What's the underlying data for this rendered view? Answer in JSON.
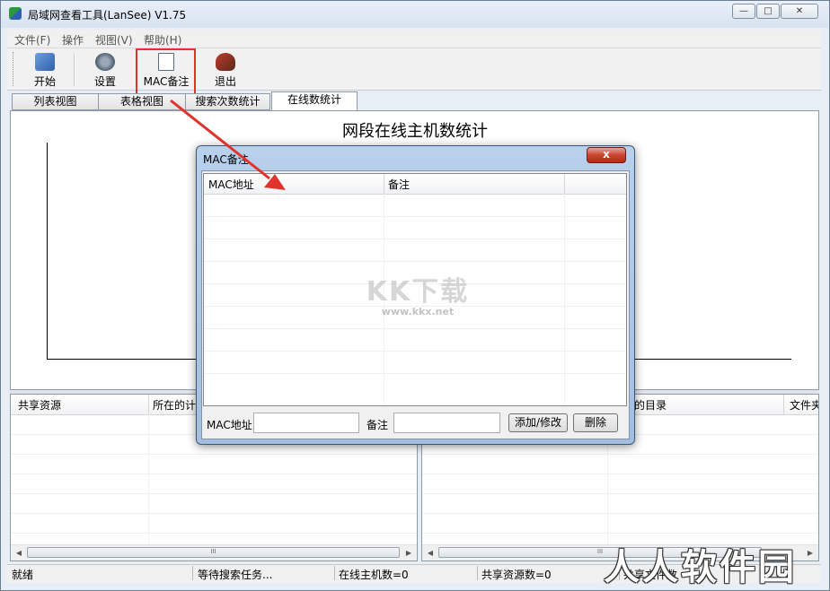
{
  "window": {
    "title": "局域网查看工具(LanSee) V1.75",
    "controls": {
      "minimize": "—",
      "maximize": "□",
      "close": "✕"
    }
  },
  "menu": [
    "文件(F)",
    "操作",
    "视图(V)",
    "帮助(H)"
  ],
  "toolbar": [
    {
      "label": "开始",
      "icon": "start-icon"
    },
    {
      "label": "设置",
      "icon": "settings-icon"
    },
    {
      "label": "MAC备注",
      "icon": "mac-note-icon"
    },
    {
      "label": "退出",
      "icon": "exit-icon"
    }
  ],
  "tabs": [
    "列表视图",
    "表格视图",
    "搜索次数统计",
    "在线数统计"
  ],
  "active_tab": "在线数统计",
  "chart": {
    "title": "网段在线主机数统计"
  },
  "left_list": {
    "columns": [
      "共享资源",
      "所在的计"
    ],
    "scroll_thumb": "III"
  },
  "right_list": {
    "columns": [
      "的目录",
      "文件夹"
    ],
    "scroll_thumb": "III"
  },
  "status": [
    "就绪",
    "等待搜索任务...",
    "在线主机数=0",
    "共享资源数=0",
    "共享文件数"
  ],
  "dialog": {
    "title": "MAC备注",
    "close_label": "x",
    "columns": [
      "MAC地址",
      "备注"
    ],
    "mac_label": "MAC地址",
    "mac_value": "",
    "note_label": "备注",
    "note_value": "",
    "add_button": "添加/修改",
    "delete_button": "删除"
  },
  "watermarks": {
    "kk": "KK下载",
    "kk_url": "www.kkx.net",
    "corner": "人人软件园"
  },
  "colors": {
    "highlight": "#e0332b"
  }
}
